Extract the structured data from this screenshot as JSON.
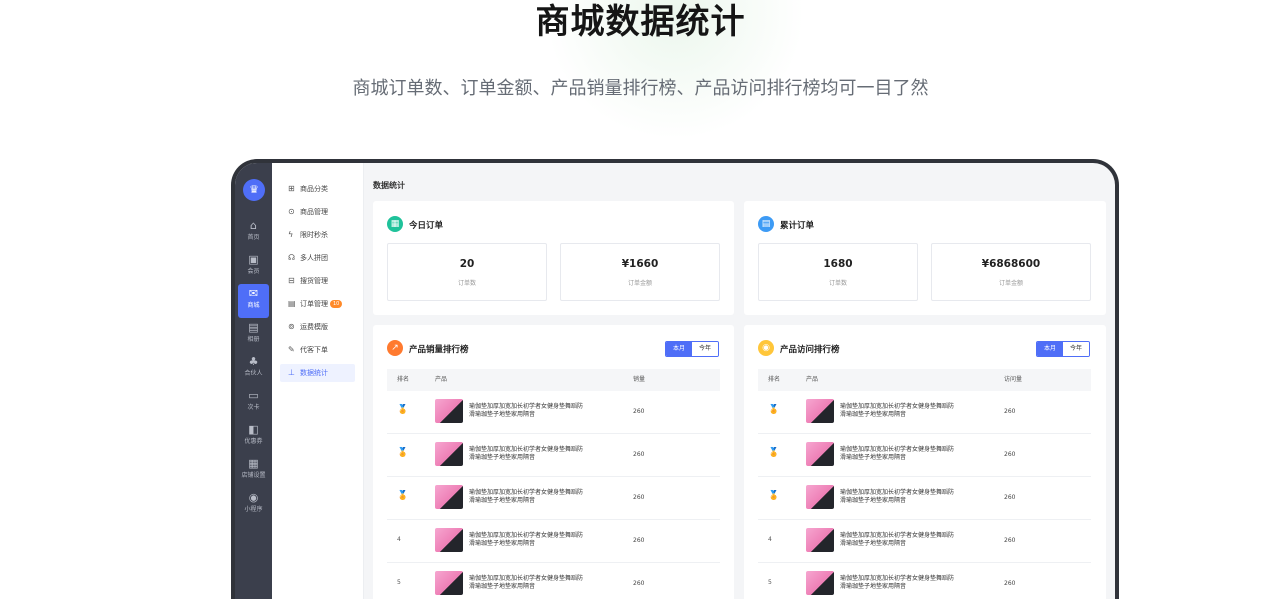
{
  "hero": {
    "title": "商城数据统计",
    "subtitle": "商城订单数、订单金额、产品销量排行榜、产品访问排行榜均可一目了然"
  },
  "rail": {
    "items": [
      {
        "label": "首页",
        "icon": "home-icon"
      },
      {
        "label": "会员",
        "icon": "member-icon"
      },
      {
        "label": "商城",
        "icon": "mall-icon",
        "active": true
      },
      {
        "label": "相册",
        "icon": "album-icon"
      },
      {
        "label": "合伙人",
        "icon": "partner-icon"
      },
      {
        "label": "次卡",
        "icon": "card-icon"
      },
      {
        "label": "优惠券",
        "icon": "coupon-icon"
      },
      {
        "label": "店铺设置",
        "icon": "store-icon"
      },
      {
        "label": "小程序",
        "icon": "miniapp-icon"
      }
    ]
  },
  "submenu": {
    "items": [
      {
        "label": "商品分类",
        "icon": "grid-icon"
      },
      {
        "label": "商品管理",
        "icon": "box-icon"
      },
      {
        "label": "限时秒杀",
        "icon": "flash-icon"
      },
      {
        "label": "多人拼团",
        "icon": "group-icon"
      },
      {
        "label": "搜货管理",
        "icon": "search-goods-icon"
      },
      {
        "label": "订单管理",
        "icon": "order-icon",
        "badge": "10"
      },
      {
        "label": "运费模版",
        "icon": "shipping-icon"
      },
      {
        "label": "代客下单",
        "icon": "proxy-order-icon"
      },
      {
        "label": "数据统计",
        "icon": "chart-icon",
        "active": true
      }
    ]
  },
  "page": {
    "title": "数据统计"
  },
  "today_orders": {
    "title": "今日订单",
    "stats": [
      {
        "value": "20",
        "label": "订单数"
      },
      {
        "value": "¥1660",
        "label": "订单金额"
      }
    ]
  },
  "total_orders": {
    "title": "累计订单",
    "stats": [
      {
        "value": "1680",
        "label": "订单数"
      },
      {
        "value": "¥6868600",
        "label": "订单金额"
      }
    ]
  },
  "sales_rank": {
    "title": "产品销量排行榜",
    "toggle": {
      "month": "本月",
      "year": "今年"
    },
    "columns": {
      "rank": "排名",
      "product": "产品",
      "metric": "销量"
    },
    "rows": [
      {
        "rank": "1",
        "product": "瑜伽垫加厚加宽加长初学者女健身垫舞蹈防滑瑜珈垫子地垫家用隔音",
        "value": "260"
      },
      {
        "rank": "2",
        "product": "瑜伽垫加厚加宽加长初学者女健身垫舞蹈防滑瑜珈垫子地垫家用隔音",
        "value": "260"
      },
      {
        "rank": "3",
        "product": "瑜伽垫加厚加宽加长初学者女健身垫舞蹈防滑瑜珈垫子地垫家用隔音",
        "value": "260"
      },
      {
        "rank": "4",
        "product": "瑜伽垫加厚加宽加长初学者女健身垫舞蹈防滑瑜珈垫子地垫家用隔音",
        "value": "260"
      },
      {
        "rank": "5",
        "product": "瑜伽垫加厚加宽加长初学者女健身垫舞蹈防滑瑜珈垫子地垫家用隔音",
        "value": "260"
      }
    ]
  },
  "visit_rank": {
    "title": "产品访问排行榜",
    "toggle": {
      "month": "本月",
      "year": "今年"
    },
    "columns": {
      "rank": "排名",
      "product": "产品",
      "metric": "访问量"
    },
    "rows": [
      {
        "rank": "1",
        "product": "瑜伽垫加厚加宽加长初学者女健身垫舞蹈防滑瑜珈垫子地垫家用隔音",
        "value": "260"
      },
      {
        "rank": "2",
        "product": "瑜伽垫加厚加宽加长初学者女健身垫舞蹈防滑瑜珈垫子地垫家用隔音",
        "value": "260"
      },
      {
        "rank": "3",
        "product": "瑜伽垫加厚加宽加长初学者女健身垫舞蹈防滑瑜珈垫子地垫家用隔音",
        "value": "260"
      },
      {
        "rank": "4",
        "product": "瑜伽垫加厚加宽加长初学者女健身垫舞蹈防滑瑜珈垫子地垫家用隔音",
        "value": "260"
      },
      {
        "rank": "5",
        "product": "瑜伽垫加厚加宽加长初学者女健身垫舞蹈防滑瑜珈垫子地垫家用隔音",
        "value": "260"
      }
    ]
  },
  "colors": {
    "accent": "#4f6ef7",
    "rail_bg": "#3b3f4c",
    "today_icon": "#1fc29a",
    "total_icon": "#3d9bf5",
    "sales_icon": "#ff7a2f",
    "visit_icon": "#ffc63a",
    "badge": "#ff8a2a"
  }
}
